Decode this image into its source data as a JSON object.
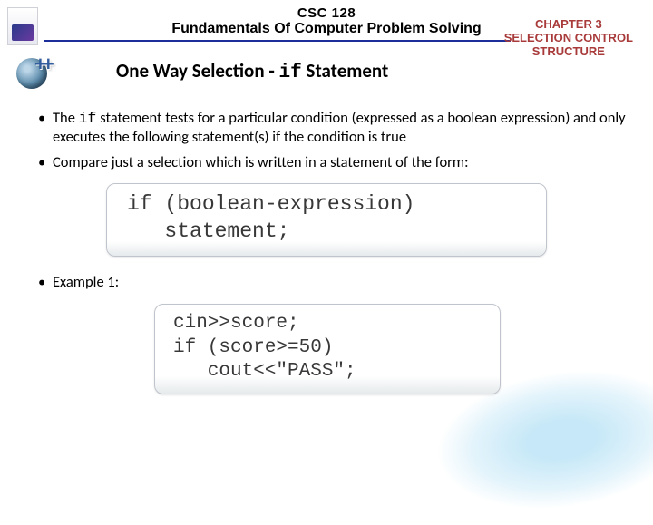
{
  "header": {
    "course_code": "CSC 128",
    "course_title": "Fundamentals Of Computer Problem Solving",
    "chapter_line1": "CHAPTER 3",
    "chapter_line2": "SELECTION CONTROL",
    "chapter_line3": "STRUCTURE"
  },
  "cpp_icon_label": "++",
  "section_title_pre": "One Way Selection - ",
  "section_title_mono": "if",
  "section_title_post": " Statement",
  "bullets": {
    "b1_pre": "The ",
    "b1_mono": "if",
    "b1_post": " statement tests for a particular condition (expressed as a boolean expression) and only executes the following statement(s) if the condition is true",
    "b2": "Compare just a selection which is written in a statement of the form:",
    "b3": "Example 1:"
  },
  "code1_line1": "if (boolean-expression)",
  "code1_line2": "   statement;",
  "code2_line1": "cin>>score;",
  "code2_line2": "if (score>=50)",
  "code2_line3": "   cout<<\"PASS\";"
}
